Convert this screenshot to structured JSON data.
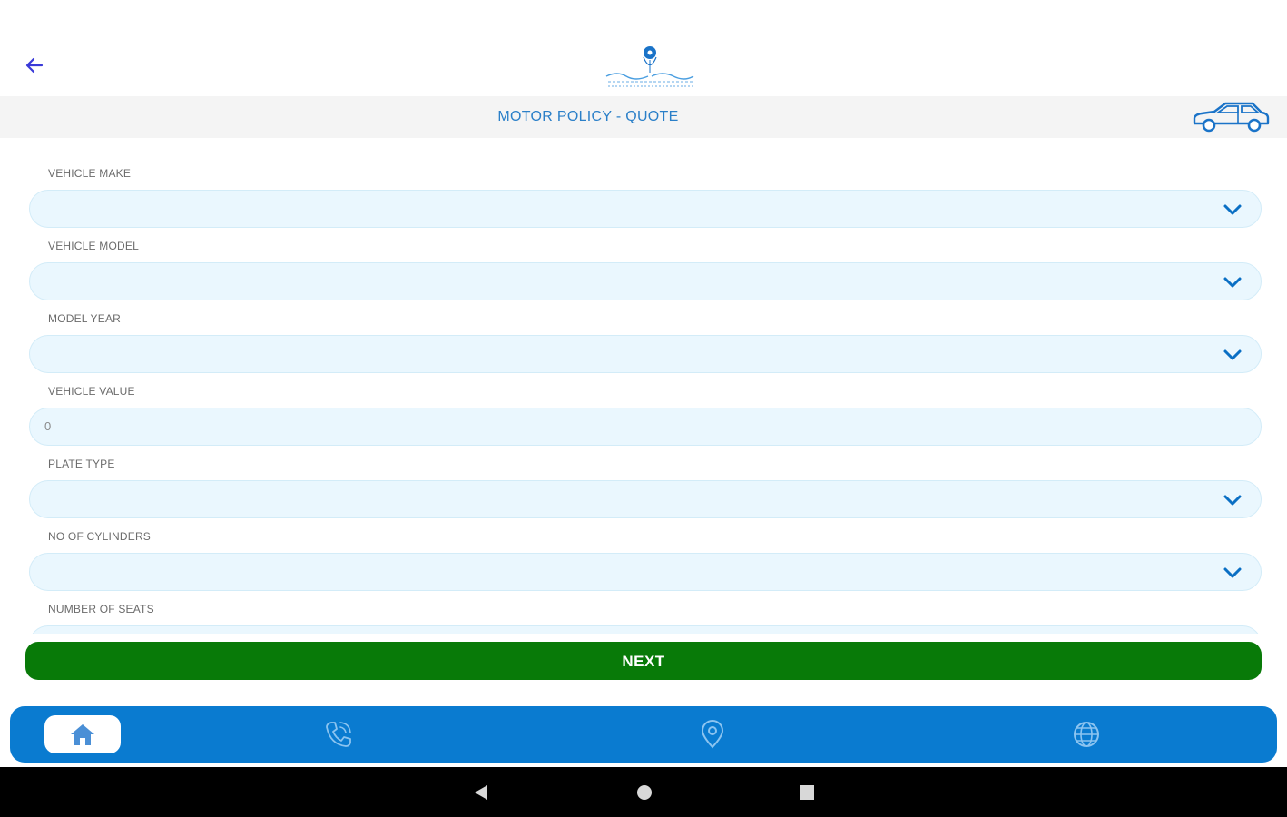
{
  "header": {
    "title": "MOTOR POLICY - QUOTE"
  },
  "form": {
    "fields": [
      {
        "label": "VEHICLE MAKE",
        "type": "select",
        "value": ""
      },
      {
        "label": "VEHICLE MODEL",
        "type": "select",
        "value": ""
      },
      {
        "label": "MODEL YEAR",
        "type": "select",
        "value": ""
      },
      {
        "label": "VEHICLE VALUE",
        "type": "input",
        "value": "0"
      },
      {
        "label": "PLATE TYPE",
        "type": "select",
        "value": ""
      },
      {
        "label": "NO OF CYLINDERS",
        "type": "select",
        "value": ""
      },
      {
        "label": "NUMBER OF SEATS",
        "type": "select",
        "value": ""
      }
    ]
  },
  "actions": {
    "next_label": "NEXT"
  },
  "bottom_nav": {
    "items": [
      {
        "icon": "home-icon",
        "active": true
      },
      {
        "icon": "phone-icon",
        "active": false
      },
      {
        "icon": "location-pin-icon",
        "active": false
      },
      {
        "icon": "globe-icon",
        "active": false
      }
    ]
  },
  "colors": {
    "accent": "#0a7bd0",
    "next_button": "#087a08",
    "field_bg": "#eaf7fe",
    "title_text": "#2a7fc8"
  }
}
